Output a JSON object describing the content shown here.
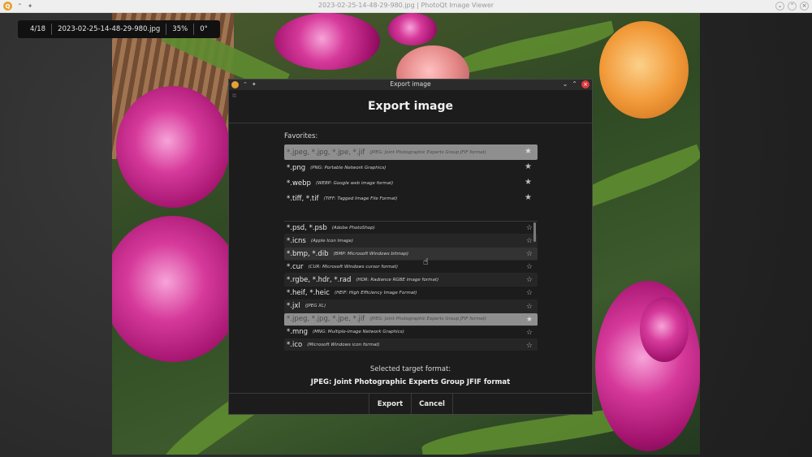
{
  "window": {
    "title": "2023-02-25-14-48-29-980.jpg | PhotoQt Image Viewer",
    "logo_icon": "photoqt-logo-icon"
  },
  "info_bar": {
    "position": "4/18",
    "filename": "2023-02-25-14-48-29-980.jpg",
    "zoom": "35%",
    "rotation": "0°"
  },
  "dialog": {
    "title": "Export image",
    "heading": "Export image",
    "favorites_label": "Favorites:",
    "favorites": [
      {
        "ext": "*.jpeg, *.jpg, *.jpe, *.jif",
        "desc": "(JPEG: Joint Photographic Experts Group JFIF format)",
        "selected": true
      },
      {
        "ext": "*.png",
        "desc": "(PNG: Portable Network Graphics)",
        "selected": false
      },
      {
        "ext": "*.webp",
        "desc": "(WEBP: Google web image format)",
        "selected": false
      },
      {
        "ext": "*.tiff, *.tif",
        "desc": "(TIFF: Tagged Image File Format)",
        "selected": false
      }
    ],
    "formats": [
      {
        "ext": "*.psd, *.psb",
        "desc": "(Adobe PhotoShop)"
      },
      {
        "ext": "*.icns",
        "desc": "(Apple Icon Image)"
      },
      {
        "ext": "*.bmp, *.dib",
        "desc": "(BMP: Microsoft Windows bitmap)"
      },
      {
        "ext": "*.cur",
        "desc": "(CUR: Microsoft Windows cursor format)"
      },
      {
        "ext": "*.rgbe, *.hdr, *.rad",
        "desc": "(HDR: Radiance RGBE image format)"
      },
      {
        "ext": "*.heif, *.heic",
        "desc": "(HEIF: High Efficiency Image Format)"
      },
      {
        "ext": "*.jxl",
        "desc": "(JPEG XL)"
      },
      {
        "ext": "*.jpeg, *.jpg, *.jpe, *.jif",
        "desc": "(JPEG: Joint Photographic Experts Group JFIF format)"
      },
      {
        "ext": "*.mng",
        "desc": "(MNG: Multiple-image Network Graphics)"
      },
      {
        "ext": "*.ico",
        "desc": "(Microsoft Windows icon format)"
      }
    ],
    "selected_label": "Selected target format:",
    "selected_value": "JPEG: Joint Photographic Experts Group JFIF format",
    "export_label": "Export",
    "cancel_label": "Cancel"
  },
  "colors": {
    "dialog_bg": "#1c1c1c",
    "selection": "#8f8f8f",
    "close_button": "#e0393e",
    "logo": "#e6a233"
  }
}
